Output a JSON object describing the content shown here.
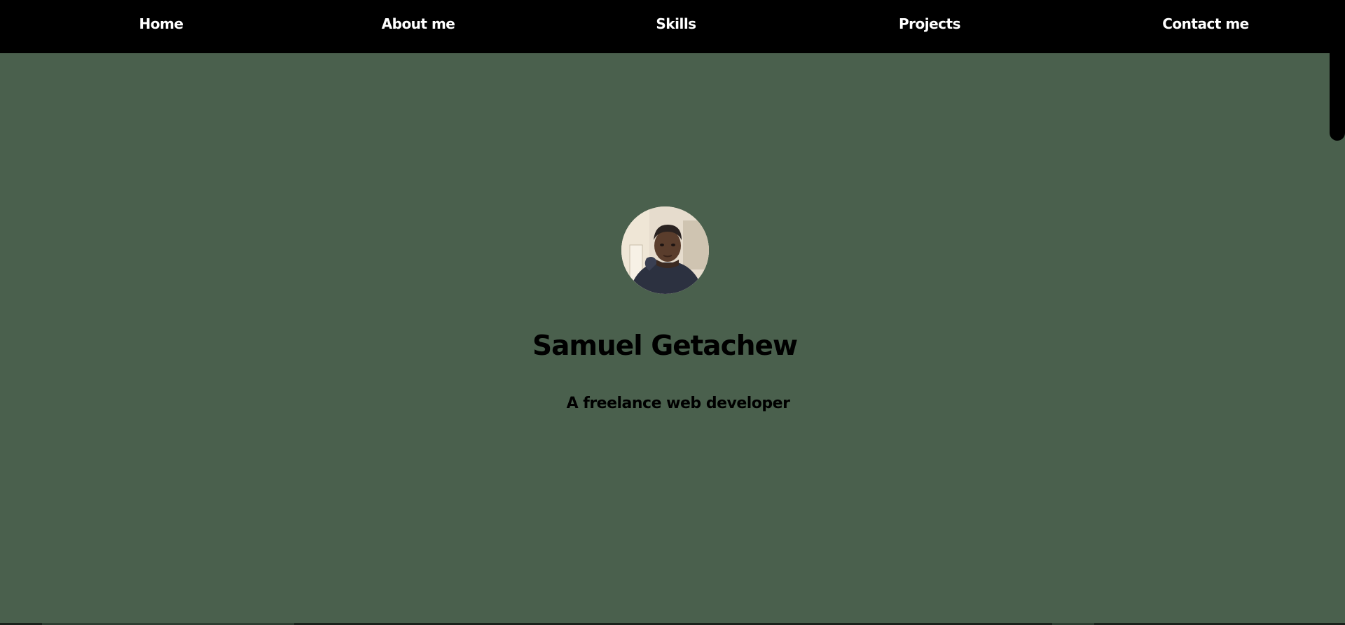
{
  "nav": {
    "items": [
      {
        "label": "Home"
      },
      {
        "label": "About me"
      },
      {
        "label": "Skills"
      },
      {
        "label": "Projects"
      },
      {
        "label": "Contact me"
      }
    ]
  },
  "hero": {
    "avatar_alt": "profile photo",
    "name": "Samuel Getachew",
    "tagline": "A freelance web developer"
  },
  "colors": {
    "background": "#4a604d",
    "navbar": "#000000",
    "nav_text": "#ffffff",
    "text": "#000000"
  }
}
